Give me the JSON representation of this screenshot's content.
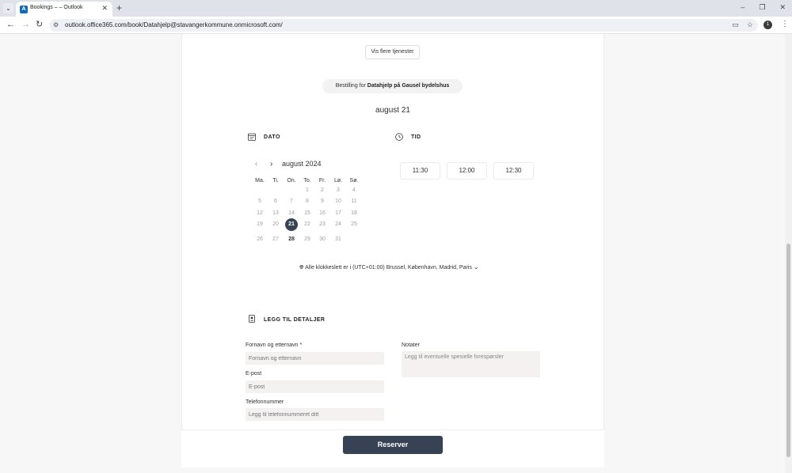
{
  "browser": {
    "tab_title": "Bookings – – Outlook",
    "tab_favicon_letter": "A",
    "url": "outlook.office365.com/book/Datahjelp@stavangerkommune.onmicrosoft.com/",
    "profile_initial": "1"
  },
  "page": {
    "more_services_button": "Vis flere tjenester",
    "booking_for_prefix": "Bestilling for",
    "booking_for_service": "Datahjelp på Gausel bydelshus",
    "selected_date_heading": "august 21",
    "date_section_title": "DATO",
    "time_section_title": "TID",
    "calendar": {
      "month_label": "august 2024",
      "weekdays": [
        "Ma.",
        "Ti.",
        "On.",
        "To.",
        "Fr.",
        "Lø.",
        "Sø."
      ],
      "weeks": [
        [
          "",
          "",
          "",
          "1",
          "2",
          "3",
          "4"
        ],
        [
          "5",
          "6",
          "7",
          "8",
          "9",
          "10",
          "11"
        ],
        [
          "12",
          "13",
          "14",
          "15",
          "16",
          "17",
          "18"
        ],
        [
          "19",
          "20",
          "21",
          "22",
          "23",
          "24",
          "25"
        ],
        [
          "26",
          "27",
          "28",
          "29",
          "30",
          "31",
          ""
        ]
      ],
      "selected_day": "21",
      "available_days": [
        "21",
        "28"
      ]
    },
    "time_slots": [
      "11:30",
      "12:00",
      "12:30"
    ],
    "timezone_prefix": "Alle klokkeslett er i",
    "timezone_value": "(UTC+01:00) Brussel, København, Madrid, Paris",
    "details_section_title": "LEGG TIL DETALJER",
    "form": {
      "name_label": "Fornavn og etternavn *",
      "name_placeholder": "Fornavn og etternavn",
      "email_label": "E-post",
      "email_placeholder": "E-post",
      "phone_label": "Telefonnummer",
      "phone_placeholder": "Legg til telefonnummeret ditt",
      "notes_label": "Notater",
      "notes_placeholder": "Legg til eventuelle spesielle forespørsler"
    },
    "reserve_button": "Reserver"
  }
}
